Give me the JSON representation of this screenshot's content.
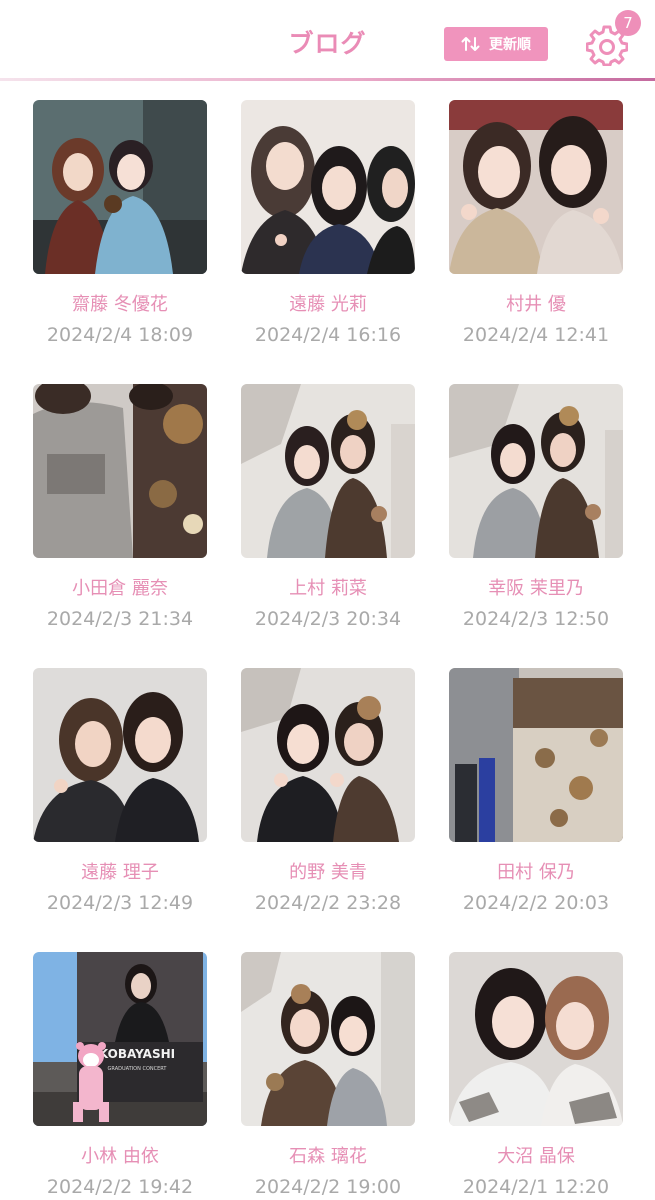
{
  "header": {
    "title": "ブログ",
    "sort_label": "更新順",
    "notification_count": "7"
  },
  "colors": {
    "accent": "#ea8bb6",
    "button": "#f094bd",
    "date_text": "#a9a9a9"
  },
  "posts": [
    {
      "author": "齋藤 冬優花",
      "date": "2024/2/4 18:09"
    },
    {
      "author": "遠藤 光莉",
      "date": "2024/2/4 16:16"
    },
    {
      "author": "村井 優",
      "date": "2024/2/4 12:41"
    },
    {
      "author": "小田倉 麗奈",
      "date": "2024/2/3 21:34"
    },
    {
      "author": "上村 莉菜",
      "date": "2024/2/3 20:34"
    },
    {
      "author": "幸阪 茉里乃",
      "date": "2024/2/3 12:50"
    },
    {
      "author": "遠藤 理子",
      "date": "2024/2/3 12:49"
    },
    {
      "author": "的野 美青",
      "date": "2024/2/2 23:28"
    },
    {
      "author": "田村 保乃",
      "date": "2024/2/2 20:03"
    },
    {
      "author": "小林 由依",
      "date": "2024/2/2 19:42"
    },
    {
      "author": "石森 璃花",
      "date": "2024/2/2 19:00"
    },
    {
      "author": "大沼 晶保",
      "date": "2024/2/1 12:20"
    }
  ],
  "photo_texts": {
    "banner_text": "KOBAYASHI",
    "banner_subtext": "GRADUATION CONCERT"
  }
}
